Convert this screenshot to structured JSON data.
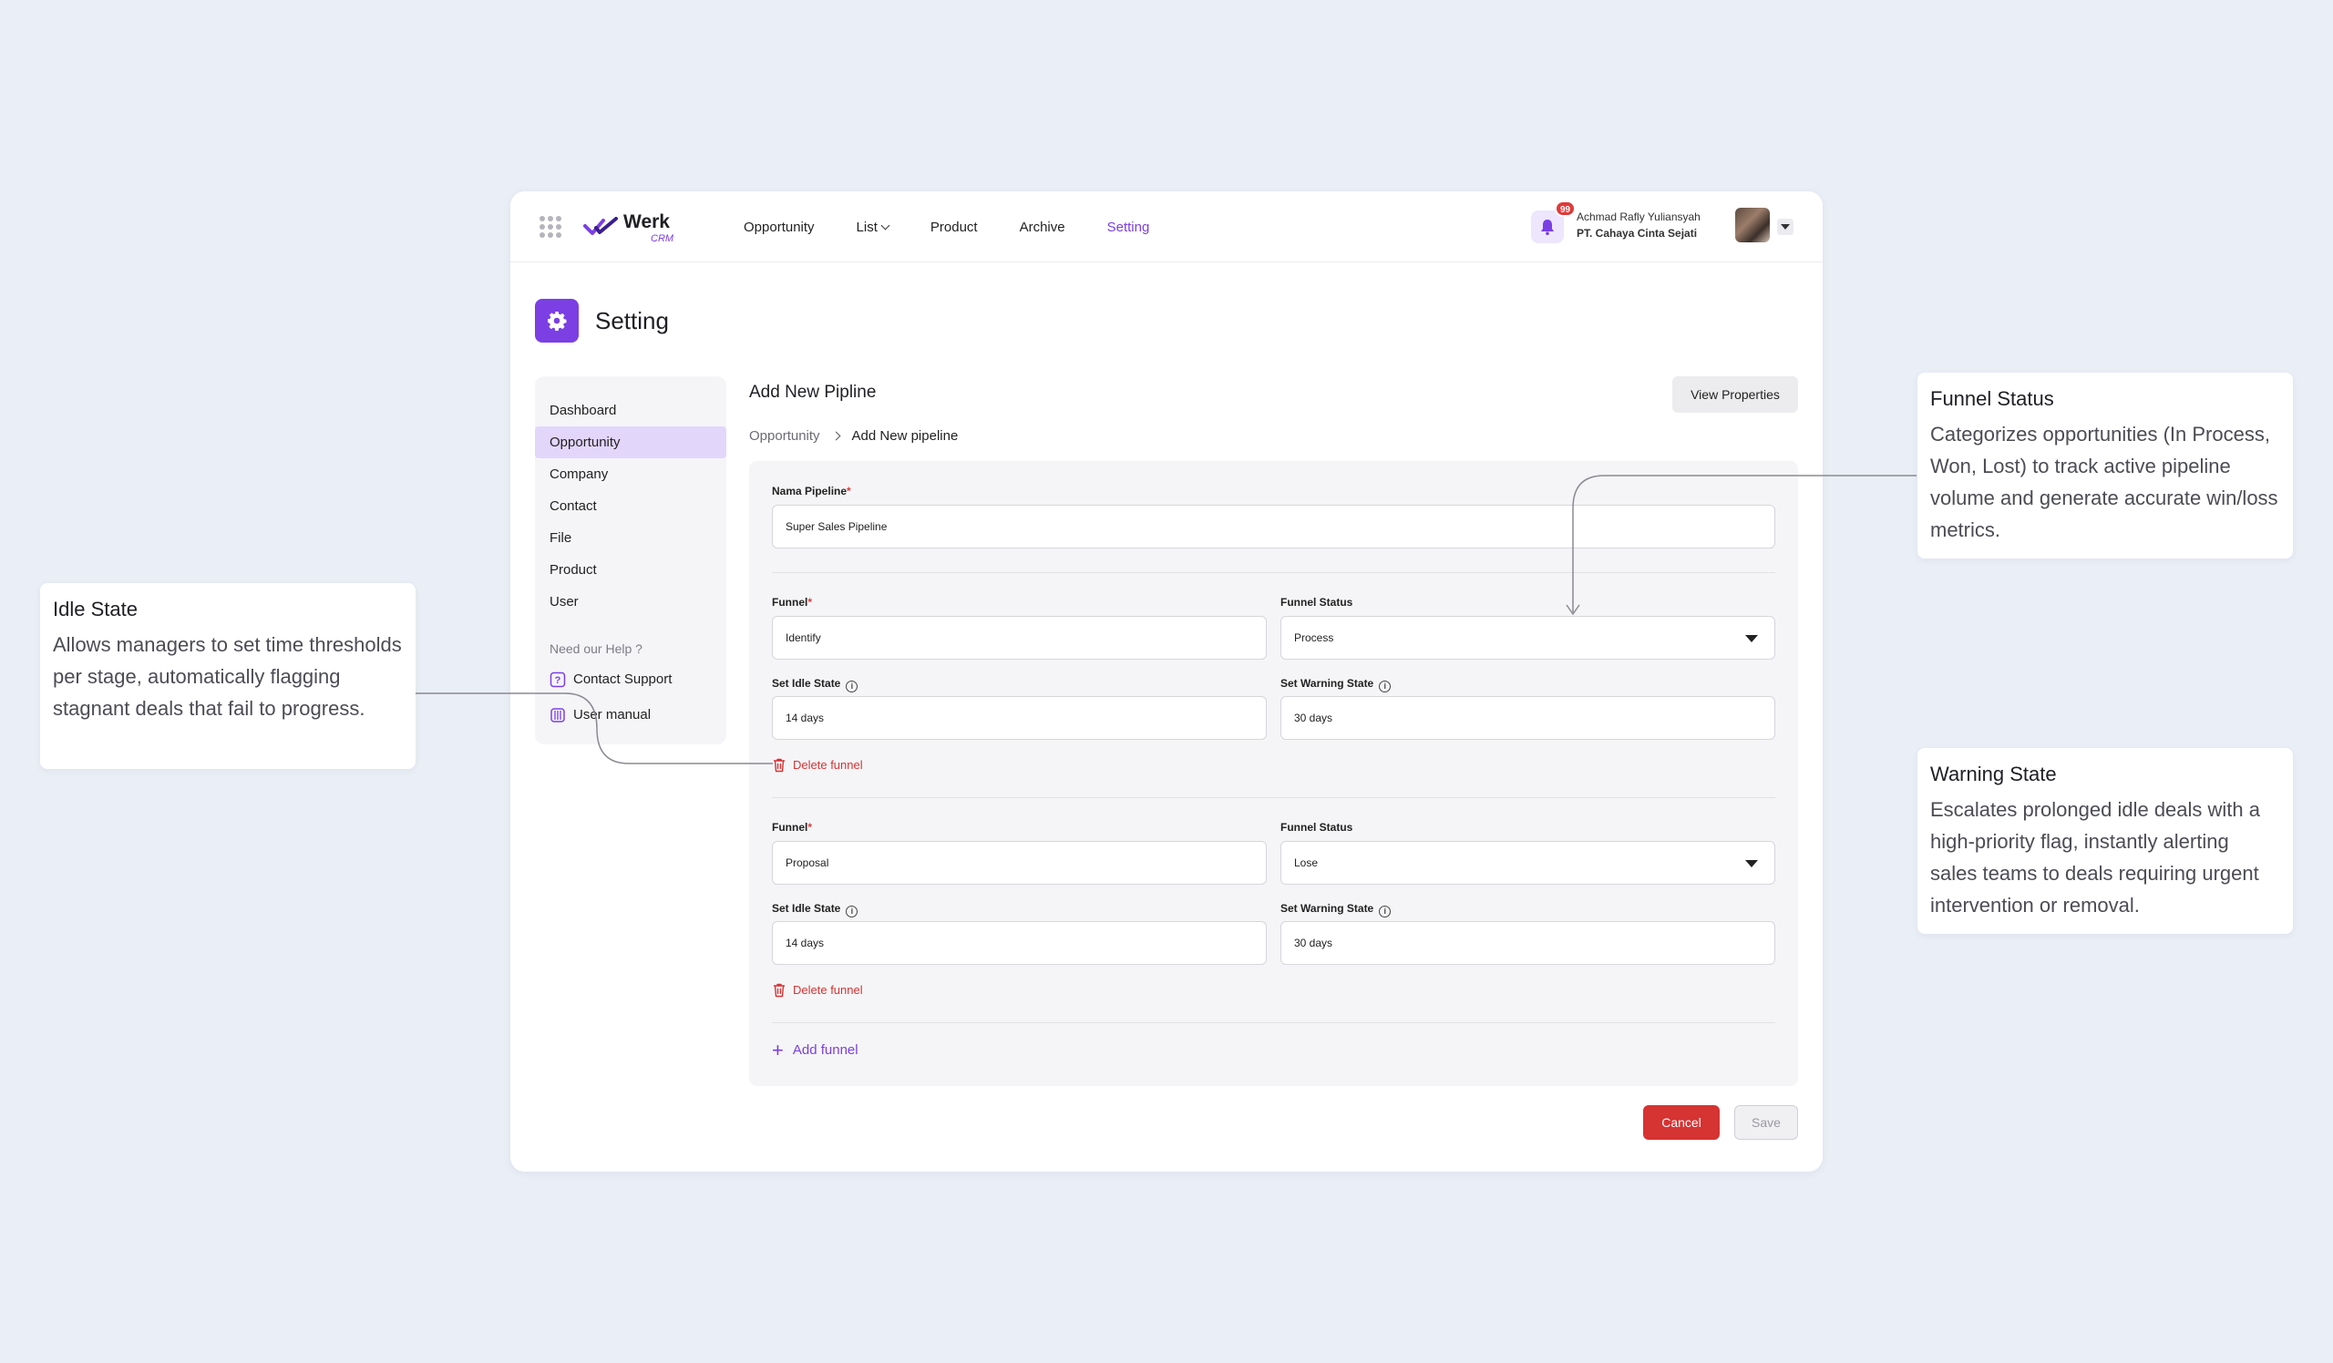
{
  "app": {
    "logo_name": "Werk",
    "logo_sub": "CRM",
    "nav": [
      {
        "label": "Opportunity",
        "dropdown": false,
        "active": false
      },
      {
        "label": "List",
        "dropdown": true,
        "active": false
      },
      {
        "label": "Product",
        "dropdown": false,
        "active": false
      },
      {
        "label": "Archive",
        "dropdown": false,
        "active": false
      },
      {
        "label": "Setting",
        "dropdown": false,
        "active": true
      }
    ],
    "notification_count": "99",
    "user_name": "Achmad Rafly Yuliansyah",
    "user_company": "PT. Cahaya Cinta Sejati",
    "accent_color": "#7b3fe4",
    "danger_color": "#d63333"
  },
  "page": {
    "title": "Setting"
  },
  "sidebar": {
    "items": [
      {
        "label": "Dashboard",
        "active": false
      },
      {
        "label": "Opportunity",
        "active": true
      },
      {
        "label": "Company",
        "active": false
      },
      {
        "label": "Contact",
        "active": false
      },
      {
        "label": "File",
        "active": false
      },
      {
        "label": "Product",
        "active": false
      },
      {
        "label": "User",
        "active": false
      }
    ],
    "help_label": "Need our Help ?",
    "help_items": [
      {
        "label": "Contact Support",
        "icon": "question-square-icon"
      },
      {
        "label": "User manual",
        "icon": "book-icon"
      }
    ]
  },
  "form": {
    "title": "Add New Pipline",
    "view_properties_label": "View Properties",
    "breadcrumb": [
      "Opportunity",
      "Add New pipeline"
    ],
    "pipeline_label": "Nama Pipeline",
    "pipeline_value": "Super Sales Pipeline",
    "funnels": [
      {
        "funnel_label": "Funnel",
        "funnel_value": "Identify",
        "status_label": "Funnel Status",
        "status_value": "Process",
        "idle_label": "Set Idle State",
        "idle_value": "14 days",
        "warning_label": "Set Warning State",
        "warning_value": "30 days",
        "delete_label": "Delete funnel"
      },
      {
        "funnel_label": "Funnel",
        "funnel_value": "Proposal",
        "status_label": "Funnel Status",
        "status_value": "Lose",
        "idle_label": "Set Idle State",
        "idle_value": "14 days",
        "warning_label": "Set Warning State",
        "warning_value": "30 days",
        "delete_label": "Delete funnel"
      }
    ],
    "add_funnel_label": "Add funnel",
    "cancel_label": "Cancel",
    "save_label": "Save"
  },
  "callouts": {
    "idle": {
      "title": "Idle State",
      "body": "Allows managers to set time thresholds per stage, automatically flagging stagnant deals that fail to progress."
    },
    "funnel_status": {
      "title": "Funnel Status",
      "body": "Categorizes opportunities (In Process, Won, Lost) to track active pipeline volume and generate accurate win/loss metrics."
    },
    "warning": {
      "title": "Warning State",
      "body": "Escalates prolonged idle deals with a high-priority flag, instantly alerting sales teams to deals requiring urgent intervention or removal."
    }
  }
}
